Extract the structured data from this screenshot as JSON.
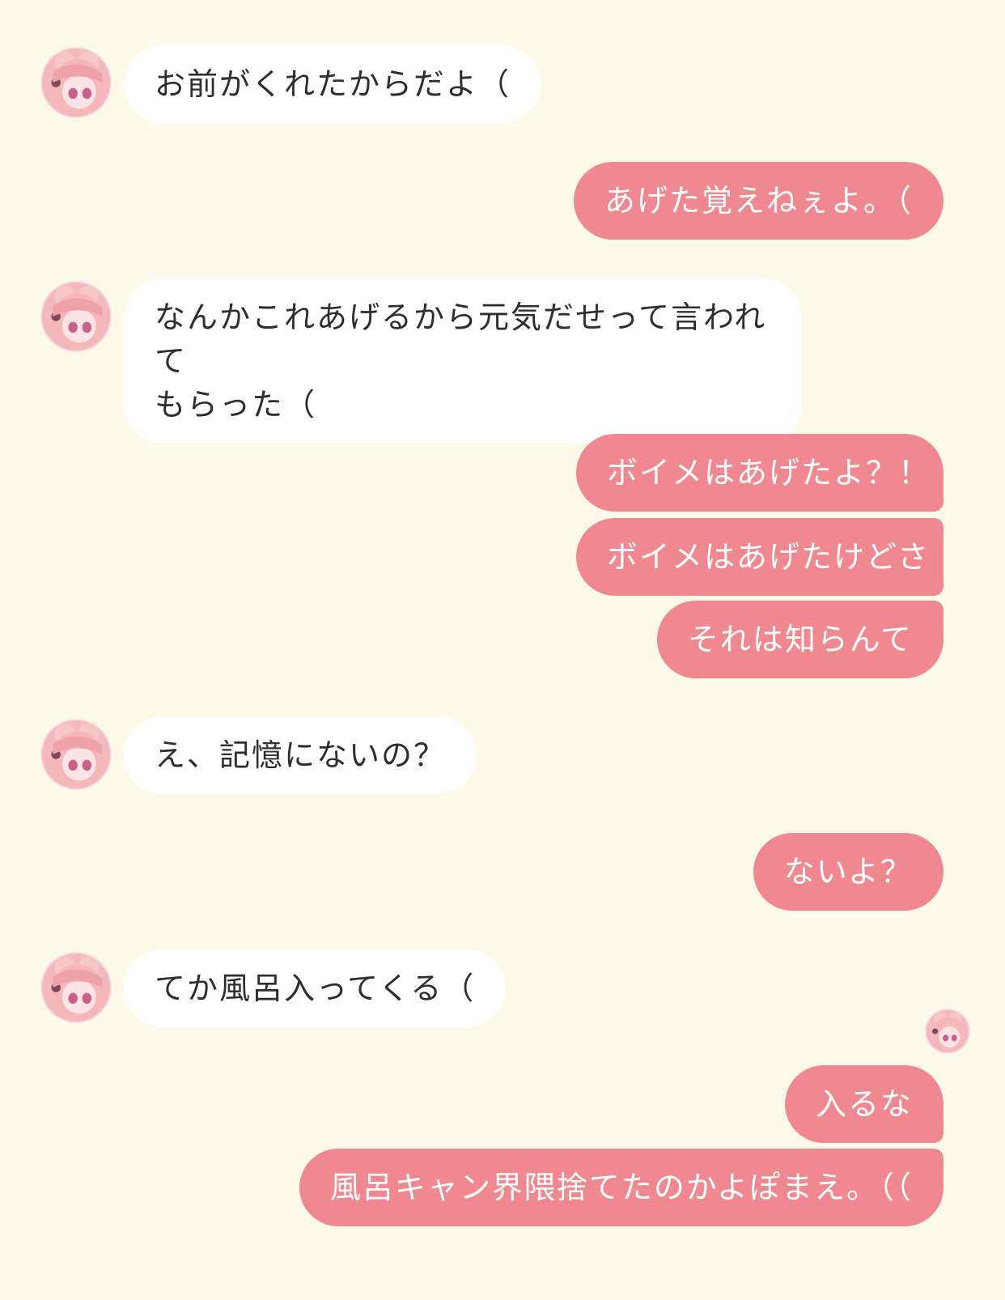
{
  "colors": {
    "background": "#fdf9e8",
    "incoming_bubble": "#ffffff",
    "outgoing_bubble": "#ef8890",
    "incoming_text": "#2e2e2e",
    "outgoing_text": "#ffffff"
  },
  "messages": {
    "m1": "お前がくれたからだよ（",
    "m2": "あげた覚えねぇよ。（",
    "m3_line1": "なんかこれあげるから元気だせって言われて",
    "m3_line2": "もらった（",
    "m4": "ボイメはあげたよ？！",
    "m5": "ボイメはあげたけどさ",
    "m6": "それは知らんて",
    "m7": "え、記憶にないの？",
    "m8": "ないよ？",
    "m9": "てか風呂入ってくる（",
    "m10": "入るな",
    "m11": "風呂キャン界隈捨てたのかよぽまえ。（（"
  },
  "icons": {
    "contact_avatar": "anime-girl-avatar-icon",
    "read_receipt_avatar": "anime-girl-avatar-icon"
  }
}
